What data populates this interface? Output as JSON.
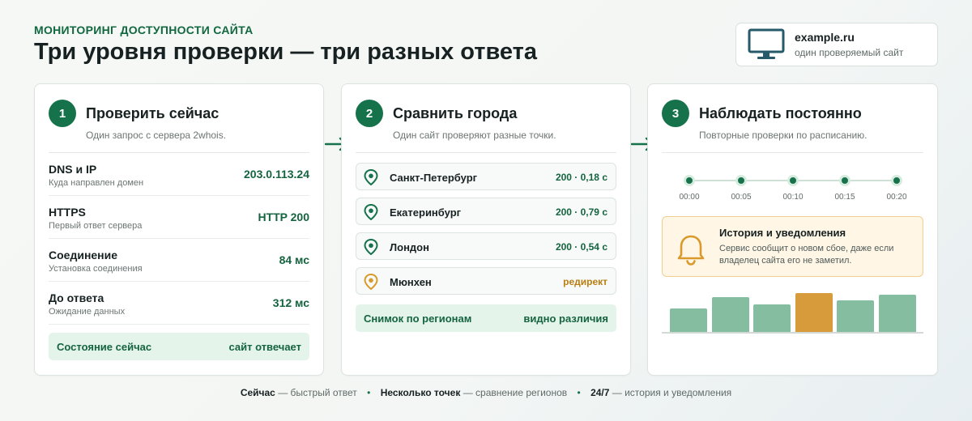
{
  "header": {
    "kicker": "МОНИТОРИНГ ДОСТУПНОСТИ САЙТА",
    "title": "Три уровня проверки — три разных ответа"
  },
  "site": {
    "domain": "example.ru",
    "description": "один проверяемый сайт",
    "icon": "monitor-icon"
  },
  "colors": {
    "accent": "#16724a",
    "accent_text": "#14643f",
    "warning": "#b97d12",
    "notice_bg": "#fff6e6",
    "bar_green": "#84bd9f",
    "bar_orange": "#d89b3b"
  },
  "card1": {
    "number": "1",
    "title": "Проверить сейчас",
    "subtitle": "Один запрос с сервера 2whois.",
    "metrics": [
      {
        "label": "DNS и IP",
        "desc": "Куда направлен домен",
        "value": "203.0.113.24"
      },
      {
        "label": "HTTPS",
        "desc": "Первый ответ сервера",
        "value": "HTTP 200"
      },
      {
        "label": "Соединение",
        "desc": "Установка соединения",
        "value": "84 мс"
      },
      {
        "label": "До ответа",
        "desc": "Ожидание данных",
        "value": "312 мс"
      }
    ],
    "state_label": "Состояние сейчас",
    "state_value": "сайт отвечает"
  },
  "card2": {
    "number": "2",
    "title": "Сравнить города",
    "subtitle": "Один сайт проверяют разные точки.",
    "cities": [
      {
        "name": "Санкт-Петербург",
        "value": "200 · 0,18 с",
        "status": "ok"
      },
      {
        "name": "Екатеринбург",
        "value": "200 · 0,79 с",
        "status": "ok"
      },
      {
        "name": "Лондон",
        "value": "200 · 0,54 с",
        "status": "ok"
      },
      {
        "name": "Мюнхен",
        "value": "редирект",
        "status": "warn"
      }
    ],
    "snapshot_label": "Снимок по регионам",
    "snapshot_value": "видно различия"
  },
  "card3": {
    "number": "3",
    "title": "Наблюдать постоянно",
    "subtitle": "Повторные проверки по расписанию.",
    "timeline": [
      "00:00",
      "00:05",
      "00:10",
      "00:15",
      "00:20"
    ],
    "notice_title": "История и уведомления",
    "notice_text": "Сервис сообщит о новом сбое, даже если владелец сайта его не заметил.",
    "bars": [
      {
        "level": 0.58,
        "highlight": false
      },
      {
        "level": 0.85,
        "highlight": false
      },
      {
        "level": 0.68,
        "highlight": false
      },
      {
        "level": 0.96,
        "highlight": true
      },
      {
        "level": 0.77,
        "highlight": false
      },
      {
        "level": 0.92,
        "highlight": false
      }
    ]
  },
  "footer": {
    "part1_bold": "Сейчас",
    "part1_text": "— быстрый ответ",
    "part2_bold": "Несколько точек",
    "part2_text": "— сравнение регионов",
    "part3_bold": "24/7",
    "part3_text": "— история и уведомления"
  }
}
